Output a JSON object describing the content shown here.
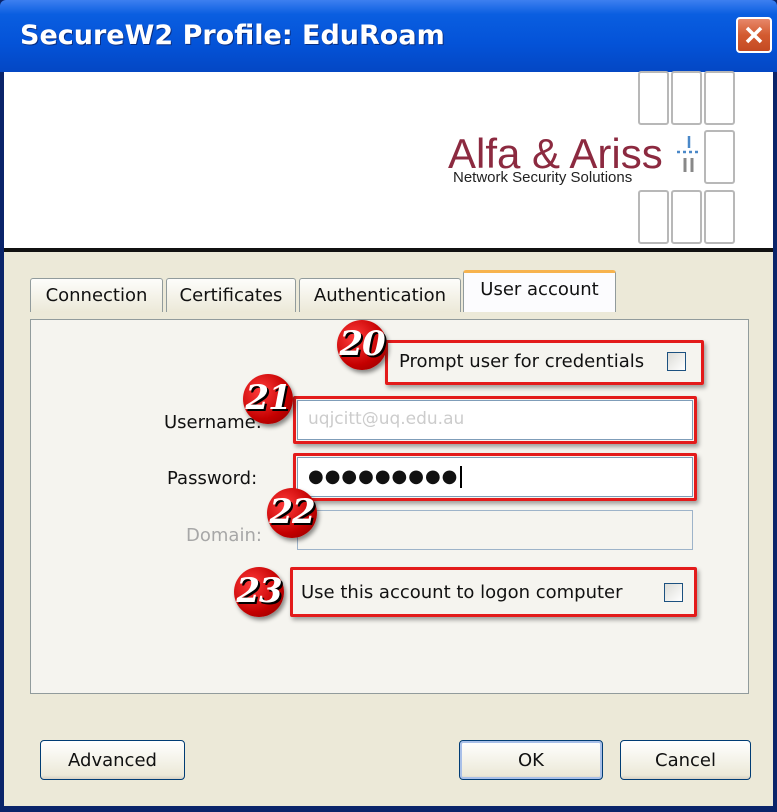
{
  "window": {
    "title": "SecureW2 Profile: EduRoam"
  },
  "logo": {
    "name": "Alfa & Ariss",
    "tagline": "Network Security Solutions"
  },
  "tabs": [
    {
      "label": "Connection"
    },
    {
      "label": "Certificates"
    },
    {
      "label": "Authentication"
    },
    {
      "label": "User account",
      "active": true
    }
  ],
  "user_account": {
    "prompt_label": "Prompt user for credentials",
    "prompt_checked": false,
    "username_label": "Username:",
    "username_value": "uqjcitt@uq.edu.au",
    "password_label": "Password:",
    "password_value": "●●●●●●●●●",
    "domain_label": "Domain:",
    "domain_value": "",
    "logon_label": "Use this account to logon computer",
    "logon_checked": false
  },
  "annotations": {
    "a20": "20",
    "a21": "21",
    "a22": "22",
    "a23": "23"
  },
  "buttons": {
    "advanced": "Advanced",
    "ok": "OK",
    "cancel": "Cancel"
  },
  "colors": {
    "titlebar": "#0453d8",
    "highlight": "#e31b1b",
    "brand": "#8c2a40",
    "dialog_bg": "#ece9d8"
  }
}
